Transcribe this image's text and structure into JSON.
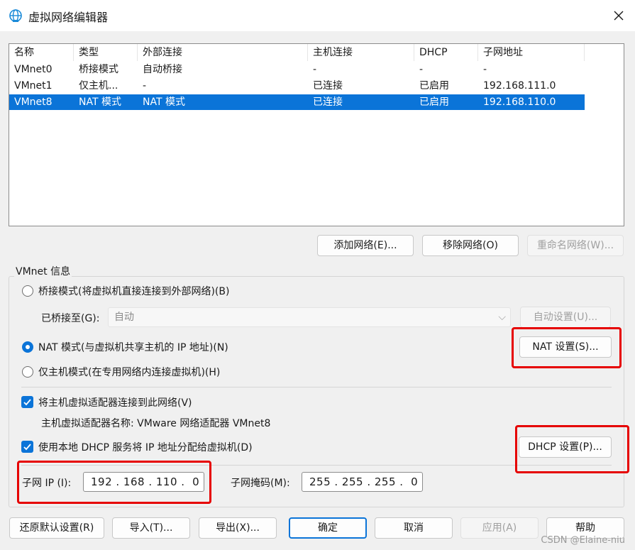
{
  "window": {
    "title": "虚拟网络编辑器",
    "icon": "globe-network-icon",
    "close_icon": "close-icon"
  },
  "networks": {
    "columns": [
      "名称",
      "类型",
      "外部连接",
      "主机连接",
      "DHCP",
      "子网地址"
    ],
    "rows": [
      [
        "VMnet0",
        "桥接模式",
        "自动桥接",
        "-",
        "-",
        "-"
      ],
      [
        "VMnet1",
        "仅主机...",
        "-",
        "已连接",
        "已启用",
        "192.168.111.0"
      ],
      [
        "VMnet8",
        "NAT 模式",
        "NAT 模式",
        "已连接",
        "已启用",
        "192.168.110.0"
      ]
    ],
    "selected_index": 2
  },
  "list_buttons": {
    "add": "添加网络(E)...",
    "remove": "移除网络(O)",
    "rename": "重命名网络(W)..."
  },
  "vmnet_info": {
    "group_label": "VMnet 信息",
    "bridged_label": "桥接模式(将虚拟机直接连接到外部网络)(B)",
    "bridged_to_label": "已桥接至(G):",
    "bridged_to_value": "自动",
    "auto_settings": "自动设置(U)...",
    "nat_label": "NAT 模式(与虚拟机共享主机的 IP 地址)(N)",
    "nat_settings": "NAT 设置(S)...",
    "hostonly_label": "仅主机模式(在专用网络内连接虚拟机)(H)",
    "selected_mode": "nat",
    "connect_adapter_label": "将主机虚拟适配器连接到此网络(V)",
    "connect_adapter_checked": true,
    "adapter_name_label": "主机虚拟适配器名称: VMware 网络适配器 VMnet8",
    "use_dhcp_label": "使用本地 DHCP 服务将 IP 地址分配给虚拟机(D)",
    "use_dhcp_checked": true,
    "dhcp_settings": "DHCP 设置(P)...",
    "subnet_ip_label": "子网 IP (I):",
    "subnet_ip_value": "192 . 168 . 110 .  0",
    "subnet_mask_label": "子网掩码(M):",
    "subnet_mask_value": "255 . 255 . 255 .  0"
  },
  "footer_buttons": {
    "restore": "还原默认设置(R)",
    "import": "导入(T)...",
    "export": "导出(X)...",
    "ok": "确定",
    "cancel": "取消",
    "apply": "应用(A)",
    "help": "帮助"
  },
  "annotation_color": "#e60000",
  "watermark": "CSDN @Elaine-niu"
}
